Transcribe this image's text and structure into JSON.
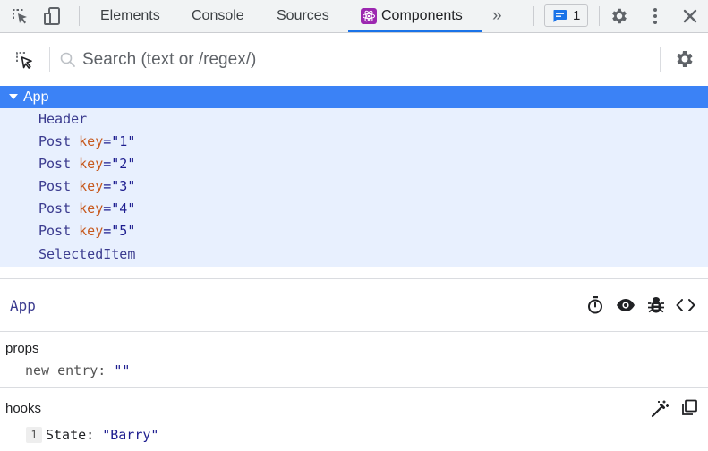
{
  "toolbar": {
    "tabs": [
      "Elements",
      "Console",
      "Sources",
      "Components"
    ],
    "active_tab": "Components",
    "more_tabs_glyph": "»",
    "issues_count": "1",
    "icons": [
      "inspect-element-icon",
      "device-toggle-icon",
      "react-logo-icon",
      "chat-issues-icon",
      "gear-icon",
      "kebab-menu-icon",
      "close-icon"
    ],
    "accent_color": "#1a73e8"
  },
  "search": {
    "placeholder": "Search (text or /regex/)",
    "value": ""
  },
  "tree": {
    "selected_color": "#3b82f6",
    "highlight_color": "#e8f0fe",
    "root": "App",
    "children": [
      {
        "name": "Header"
      },
      {
        "name": "Post",
        "key_label": "key",
        "eq": "=",
        "key_value": "\"1\""
      },
      {
        "name": "Post",
        "key_label": "key",
        "eq": "=",
        "key_value": "\"2\""
      },
      {
        "name": "Post",
        "key_label": "key",
        "eq": "=",
        "key_value": "\"3\""
      },
      {
        "name": "Post",
        "key_label": "key",
        "eq": "=",
        "key_value": "\"4\""
      },
      {
        "name": "Post",
        "key_label": "key",
        "eq": "=",
        "key_value": "\"5\""
      },
      {
        "name": "SelectedItem"
      }
    ]
  },
  "inspector": {
    "component_name": "App",
    "actions": [
      "stopwatch-icon",
      "eye-icon",
      "bug-icon",
      "code-brackets-icon"
    ],
    "props": {
      "title": "props",
      "items": [
        {
          "key": "new entry",
          "colon": ":",
          "value": "\"\""
        }
      ]
    },
    "hooks": {
      "title": "hooks",
      "items": [
        {
          "index": "1",
          "name": "State",
          "colon": ":",
          "value": "\"Barry\""
        }
      ]
    }
  }
}
